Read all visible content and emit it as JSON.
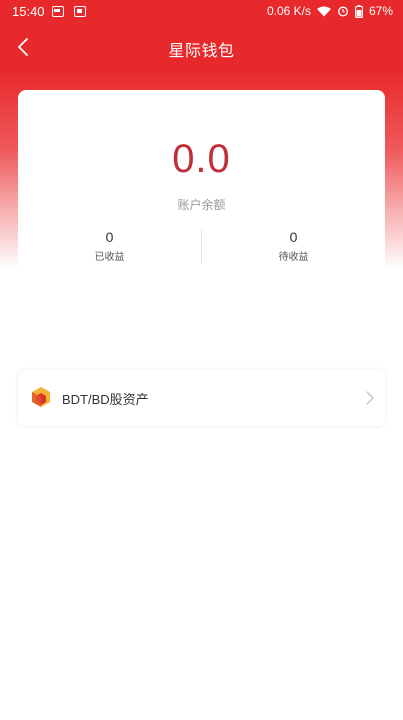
{
  "status_bar": {
    "time": "15:40",
    "network_speed": "0.06 K/s",
    "battery": "67%"
  },
  "header": {
    "title": "星际钱包"
  },
  "balance": {
    "amount": "0.0",
    "label": "账户余额",
    "earned_value": "0",
    "earned_label": "已收益",
    "pending_value": "0",
    "pending_label": "待收益"
  },
  "assets": {
    "item_label": "BDT/BD股资产"
  },
  "colors": {
    "brand_red": "#e8292b",
    "amount_red": "#c0303a"
  }
}
